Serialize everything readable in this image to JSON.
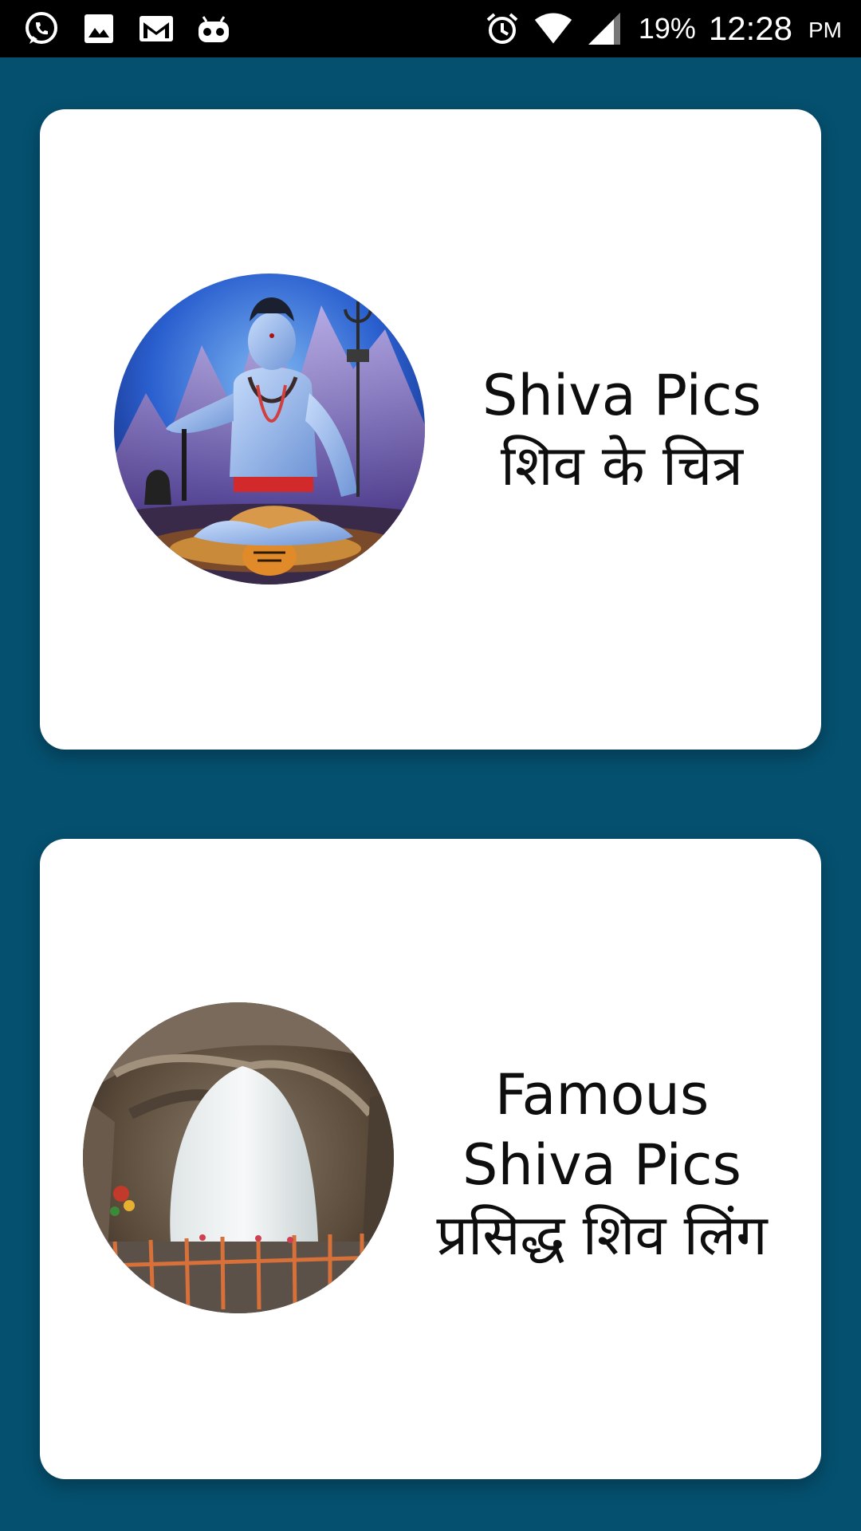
{
  "status_bar": {
    "left_icons": [
      "whatsapp-icon",
      "gallery-icon",
      "gmail-icon",
      "robot-icon"
    ],
    "right_icons": [
      "alarm-icon",
      "wifi-icon",
      "signal-icon"
    ],
    "battery": "19%",
    "time": "12:28",
    "ampm": "PM"
  },
  "colors": {
    "background": "#05506f",
    "card": "#ffffff",
    "text": "#0e0e0e"
  },
  "cards": [
    {
      "lines": [
        "Shiva Pics",
        "शिव के चित्र"
      ],
      "image": "shiva-seated-image"
    },
    {
      "lines": [
        "Famous",
        "Shiva Pics",
        "प्रसिद्ध शिव लिंग"
      ],
      "image": "ice-lingam-cave-image"
    }
  ]
}
